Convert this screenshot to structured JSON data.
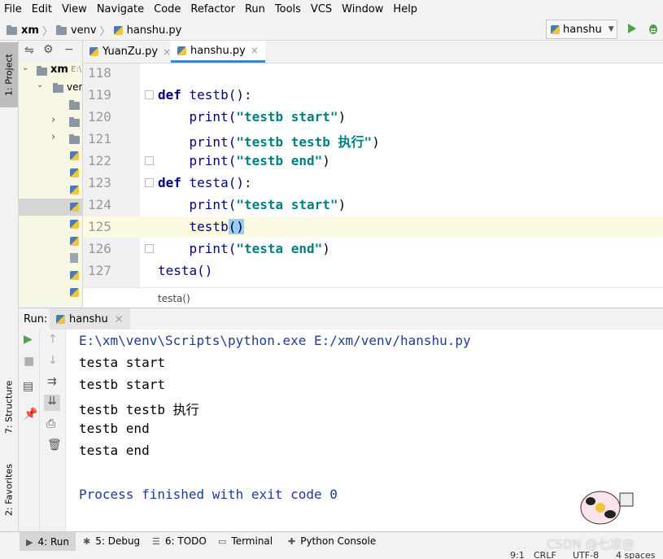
{
  "menu": [
    "File",
    "Edit",
    "View",
    "Navigate",
    "Code",
    "Refactor",
    "Run",
    "Tools",
    "VCS",
    "Window",
    "Help"
  ],
  "nav": {
    "project": "xm",
    "folder": "venv",
    "file": "hanshu.py"
  },
  "run_config": {
    "name": "hanshu"
  },
  "left_stripe": {
    "project_tab": "1: Project",
    "structure_tab": "7: Structure",
    "favorites_tab": "2: Favorites"
  },
  "project": {
    "root": "xm",
    "root_hint": "E:\\",
    "child": "ven"
  },
  "editor_tabs": [
    {
      "label": "YuanZu.py"
    },
    {
      "label": "hanshu.py"
    }
  ],
  "code": {
    "line_numbers": [
      "118",
      "119",
      "120",
      "121",
      "122",
      "123",
      "124",
      "125",
      "126",
      "127"
    ],
    "lines": [
      {
        "parts": []
      },
      {
        "parts": [
          {
            "t": "def ",
            "c": "kw"
          },
          {
            "t": "testb():",
            "c": ""
          }
        ]
      },
      {
        "parts": [
          {
            "t": "    print(",
            "c": ""
          },
          {
            "t": "\"testb start\"",
            "c": "str"
          },
          {
            "t": ")",
            "c": ""
          }
        ]
      },
      {
        "parts": [
          {
            "t": "    print(",
            "c": ""
          },
          {
            "t": "\"testb testb 执行\"",
            "c": "str"
          },
          {
            "t": ")",
            "c": ""
          }
        ]
      },
      {
        "parts": [
          {
            "t": "    print(",
            "c": ""
          },
          {
            "t": "\"testb end\"",
            "c": "str"
          },
          {
            "t": ")",
            "c": ""
          }
        ]
      },
      {
        "parts": [
          {
            "t": "def ",
            "c": "kw"
          },
          {
            "t": "testa():",
            "c": ""
          }
        ]
      },
      {
        "parts": [
          {
            "t": "    print(",
            "c": ""
          },
          {
            "t": "\"testa start\"",
            "c": "str"
          },
          {
            "t": ")",
            "c": ""
          }
        ]
      },
      {
        "parts": [
          {
            "t": "    testb",
            "c": ""
          },
          {
            "t": "()",
            "c": "sel"
          }
        ]
      },
      {
        "parts": [
          {
            "t": "    print(",
            "c": ""
          },
          {
            "t": "\"testa end\"",
            "c": "str"
          },
          {
            "t": ")",
            "c": ""
          }
        ]
      },
      {
        "parts": [
          {
            "t": "testa()",
            "c": ""
          }
        ]
      }
    ],
    "breadcrumb": "testa()"
  },
  "run": {
    "label": "Run:",
    "tab": "hanshu",
    "console": [
      "E:\\xm\\venv\\Scripts\\python.exe E:/xm/venv/hanshu.py",
      "testa start",
      "testb start",
      "testb testb 执行",
      "testb end",
      "testa end",
      "",
      "Process finished with exit code 0"
    ]
  },
  "bottom_tabs": [
    {
      "label": "4: Run"
    },
    {
      "label": "5: Debug"
    },
    {
      "label": "6: TODO"
    },
    {
      "label": "Terminal"
    },
    {
      "label": "Python Console"
    }
  ],
  "status": {
    "position": "9:1",
    "line_sep": "CRLF",
    "encoding": "UTF-8",
    "indent": "4 spaces"
  },
  "watermark": "CSDN @七凉@",
  "colors": {
    "keyword": "#000080",
    "string": "#008080",
    "console_path": "#1c3b9c",
    "run_green": "#4ca34a"
  }
}
